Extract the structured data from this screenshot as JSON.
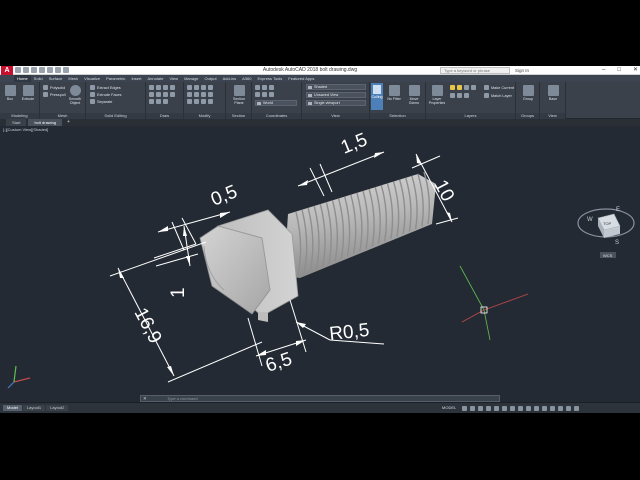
{
  "app": {
    "title": "Autodesk AutoCAD 2018    bolt drawing.dwg",
    "logo": "A",
    "search_placeholder": "Type a keyword or phrase",
    "signin": "Sign In"
  },
  "ribbon_tabs": [
    "Home",
    "Solid",
    "Surface",
    "Mesh",
    "Visualize",
    "Parametric",
    "Insert",
    "Annotate",
    "View",
    "Manage",
    "Output",
    "Add-ins",
    "A360",
    "Express Tools",
    "Featured Apps"
  ],
  "ribbon": {
    "modeling": {
      "label": "Modeling",
      "box": "Box",
      "extrude": "Extrude"
    },
    "mesh": {
      "label": "Mesh",
      "smooth_object": "Smooth Object",
      "polysolid": "Polysolid",
      "presspull": "Presspull"
    },
    "solid_editing": {
      "label": "Solid Editing",
      "extract_edges": "Extract Edges",
      "extrude_faces": "Extrude Faces",
      "separate": "Separate"
    },
    "draw": {
      "label": "Draw"
    },
    "modify": {
      "label": "Modify"
    },
    "section": {
      "label": "Section",
      "section_plane": "Section Plane"
    },
    "coordinates": {
      "label": "Coordinates",
      "world": "World"
    },
    "view": {
      "label": "View",
      "visual_style": "Shaded",
      "view_preset": "Unsaved View",
      "viewport": "Single viewport"
    },
    "selection": {
      "label": "Selection",
      "culling": "Culling",
      "no_filter": "No Filter",
      "move_gizmo": "Move Gizmo"
    },
    "layers": {
      "label": "Layers",
      "layer_properties": "Layer Properties",
      "make_current": "Make Current",
      "match_layer": "Match Layer"
    },
    "groups": {
      "label": "Groups",
      "group": "Group"
    },
    "view2": {
      "label": "View",
      "base": "Base"
    }
  },
  "doc_tabs": [
    {
      "label": "Start",
      "active": false
    },
    {
      "label": "bolt drawing",
      "active": true
    }
  ],
  "doc_tab_plus": "+",
  "viewport_label": "[-][Custom View][Shaded]",
  "dimensions": {
    "d1": "1,5",
    "d2": "0,5",
    "d3": "10",
    "d4": "1",
    "d5": "16,9",
    "d6": "6,5",
    "d7": "R0,5"
  },
  "viewcube": {
    "top_face": "TOP",
    "s": "S",
    "w": "W",
    "e": "E",
    "wcs": "WCS"
  },
  "command_line": {
    "close": "✕",
    "placeholder": "Type a command"
  },
  "layout_tabs": [
    {
      "label": "Model",
      "active": true
    },
    {
      "label": "Layout1",
      "active": false
    },
    {
      "label": "Layout2",
      "active": false
    }
  ],
  "status": {
    "model": "MODEL"
  },
  "colors": {
    "accent": "#4d7fb8",
    "canvas": "#242a33",
    "bolt_body": "#c4c4c4",
    "dimension": "#ffffff"
  }
}
